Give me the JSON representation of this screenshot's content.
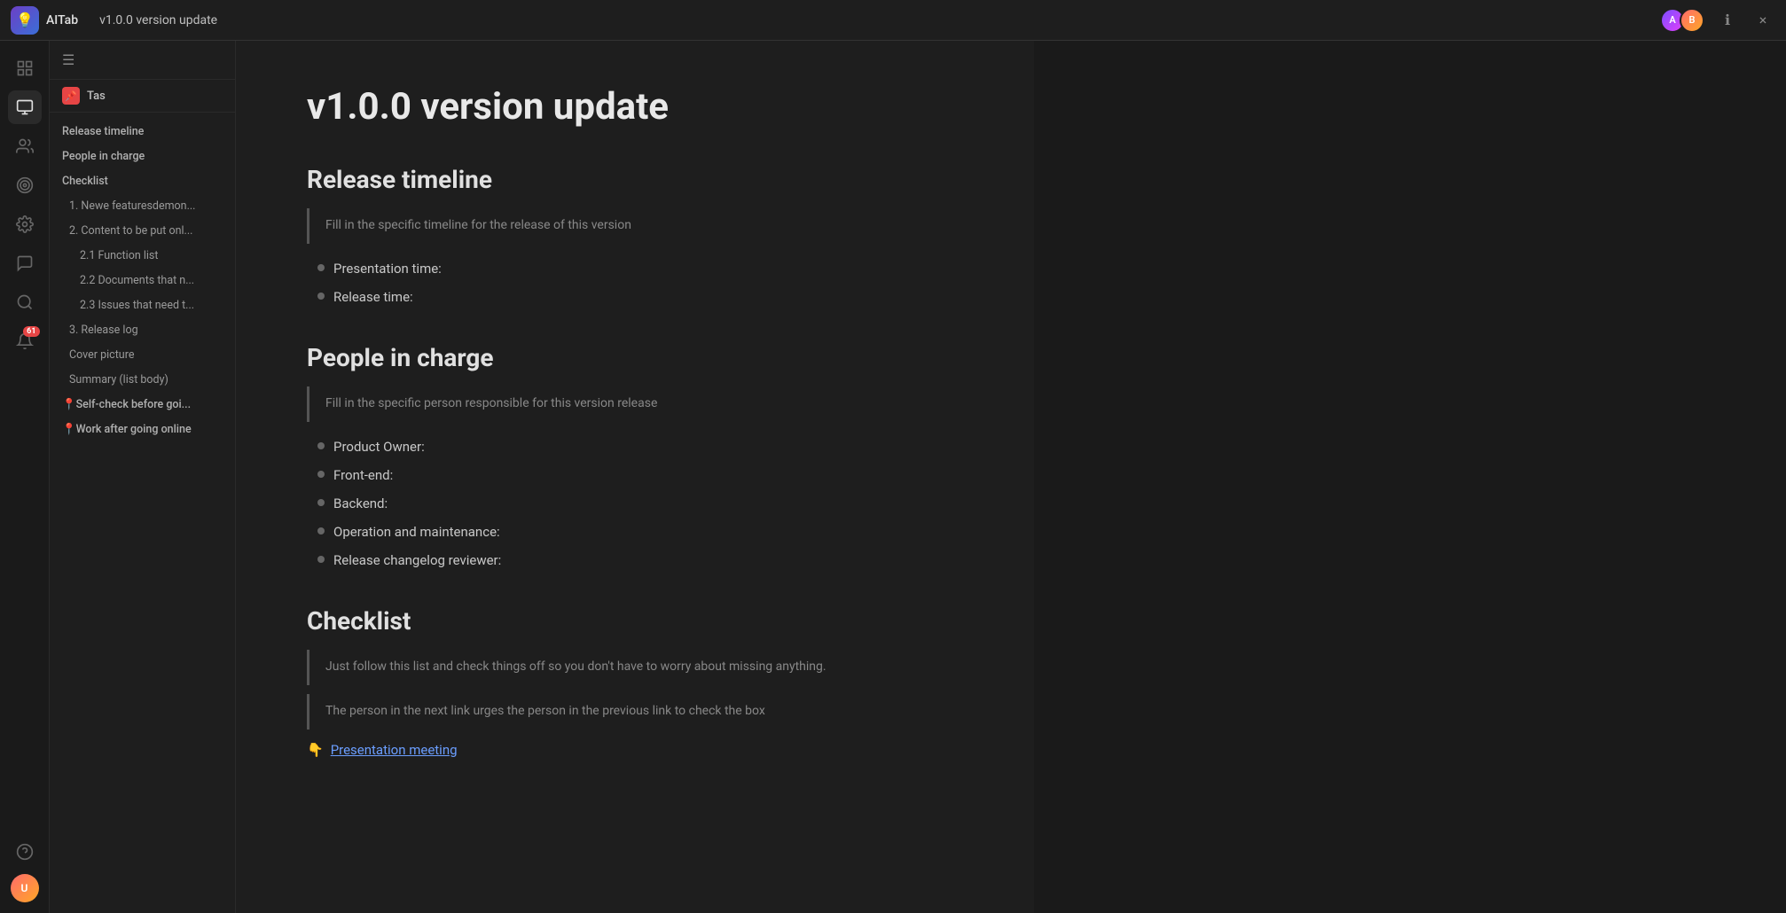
{
  "titlebar": {
    "logo_emoji": "💡",
    "app_name": "AITab",
    "doc_name": "v1.0.0 version update",
    "close_label": "×"
  },
  "sidebar": {
    "workspace_emoji": "📌",
    "workspace_label": "Tas",
    "collapse_icon": "≡",
    "items": [
      {
        "id": "release-timeline",
        "label": "Release timeline",
        "level": 1
      },
      {
        "id": "people-in-charge",
        "label": "People in charge",
        "level": 1
      },
      {
        "id": "checklist",
        "label": "Checklist",
        "level": 1
      },
      {
        "id": "newe-features",
        "label": "1. Newe featuresdemon...",
        "level": 2
      },
      {
        "id": "content-to-be",
        "label": "2. Content to be put onl...",
        "level": 2
      },
      {
        "id": "function-list",
        "label": "2.1 Function list",
        "level": 3
      },
      {
        "id": "documents-that",
        "label": "2.2 Documents that n...",
        "level": 3
      },
      {
        "id": "issues-that-need",
        "label": "2.3 Issues that need t...",
        "level": 3
      },
      {
        "id": "release-log",
        "label": "3. Release log",
        "level": 2
      },
      {
        "id": "cover-picture",
        "label": "Cover picture",
        "level": 2
      },
      {
        "id": "summary-list-body",
        "label": "Summary (list body)",
        "level": 2
      },
      {
        "id": "self-check",
        "label": "📍Self-check before goi...",
        "level": 1
      },
      {
        "id": "work-after",
        "label": "📍Work after going online",
        "level": 1
      }
    ]
  },
  "nav_icons": [
    {
      "id": "explorer",
      "icon": "⊞",
      "label": "Explorer",
      "active": true
    },
    {
      "id": "monitor",
      "icon": "🖥",
      "label": "Monitor",
      "active": false
    },
    {
      "id": "users",
      "icon": "👥",
      "label": "Users",
      "active": false
    },
    {
      "id": "target",
      "icon": "🎯",
      "label": "Target",
      "active": false
    },
    {
      "id": "settings",
      "icon": "⚙",
      "label": "Settings",
      "active": false
    },
    {
      "id": "chat",
      "icon": "💬",
      "label": "Chat",
      "active": false
    },
    {
      "id": "search",
      "icon": "🔍",
      "label": "Search",
      "active": false
    },
    {
      "id": "notifications",
      "icon": "🔔",
      "label": "Notifications",
      "badge": "61",
      "active": false
    },
    {
      "id": "help",
      "icon": "❓",
      "label": "Help",
      "active": false
    }
  ],
  "content": {
    "doc_title": "v1.0.0 version update",
    "sections": [
      {
        "id": "release-timeline",
        "heading": "Release timeline",
        "blockquote": "Fill in the specific timeline for the release of this version",
        "bullets": [
          "Presentation time:",
          "Release time:"
        ]
      },
      {
        "id": "people-in-charge",
        "heading": "People in charge",
        "blockquote": "Fill in the specific person responsible for this version release",
        "bullets": [
          "Product Owner:",
          "Front-end:",
          "Backend:",
          "Operation and maintenance:",
          "Release changelog reviewer:"
        ]
      },
      {
        "id": "checklist",
        "heading": "Checklist",
        "blockquotes": [
          "Just follow this list and check things off so you don't have to worry about missing anything.",
          "The person in the next link urges the person in the previous link to check the box"
        ],
        "special_item": "👇Presentation meeting"
      }
    ]
  }
}
